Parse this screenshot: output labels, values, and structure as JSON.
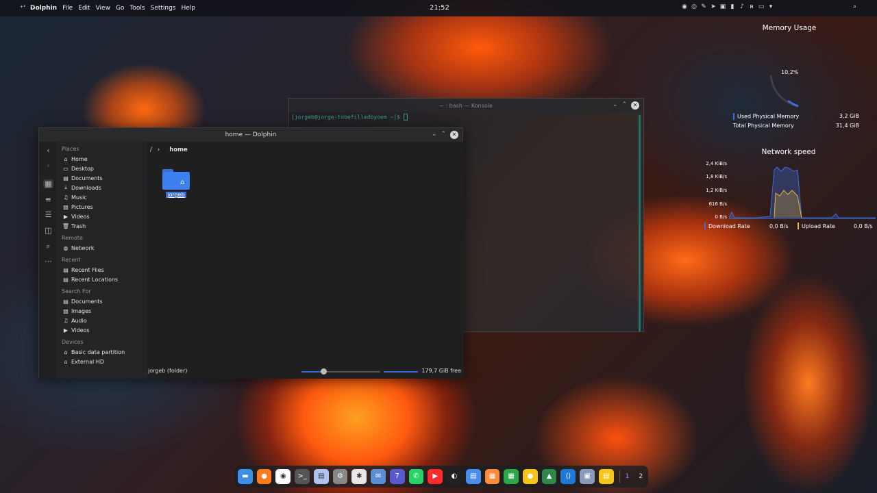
{
  "topbar": {
    "app": "Dolphin",
    "menu": [
      "File",
      "Edit",
      "View",
      "Go",
      "Tools",
      "Settings",
      "Help"
    ],
    "clock": "21:52"
  },
  "konsole": {
    "title": "~ : bash — Konsole",
    "prompt": "[jorgeb@jorge-tobefilledbyoem ~]$"
  },
  "dolphin": {
    "title": "home — Dolphin",
    "breadcrumb_root": "/",
    "breadcrumb_current": "home",
    "places": [
      {
        "header": "Places",
        "items": [
          {
            "icon": "home-icon",
            "label": "Home"
          },
          {
            "icon": "desktop-icon",
            "label": "Desktop"
          },
          {
            "icon": "documents-icon",
            "label": "Documents"
          },
          {
            "icon": "downloads-icon",
            "label": "Downloads"
          },
          {
            "icon": "music-icon",
            "label": "Music"
          },
          {
            "icon": "pictures-icon",
            "label": "Pictures"
          },
          {
            "icon": "videos-icon",
            "label": "Videos"
          },
          {
            "icon": "trash-icon",
            "label": "Trash"
          }
        ]
      },
      {
        "header": "Remote",
        "items": [
          {
            "icon": "network-icon",
            "label": "Network"
          }
        ]
      },
      {
        "header": "Recent",
        "items": [
          {
            "icon": "recent-files-icon",
            "label": "Recent Files"
          },
          {
            "icon": "recent-locations-icon",
            "label": "Recent Locations"
          }
        ]
      },
      {
        "header": "Search For",
        "items": [
          {
            "icon": "documents-icon",
            "label": "Documents"
          },
          {
            "icon": "images-icon",
            "label": "Images"
          },
          {
            "icon": "audio-icon",
            "label": "Audio"
          },
          {
            "icon": "videos-icon",
            "label": "Videos"
          }
        ]
      },
      {
        "header": "Devices",
        "items": [
          {
            "icon": "drive-icon",
            "label": "Basic data partition"
          },
          {
            "icon": "drive-icon",
            "label": "External HD"
          }
        ]
      }
    ],
    "folder": "jorgeb",
    "status": "jorgeb (folder)",
    "free": "179,7 GiB free"
  },
  "memory": {
    "title": "Memory Usage",
    "percent": "10,2%",
    "used_label": "Used Physical Memory",
    "used_value": "3,2 GiB",
    "total_label": "Total Physical Memory",
    "total_value": "31,4 GiB",
    "accent": "#3d6edb"
  },
  "network": {
    "title": "Network speed",
    "y_ticks": [
      "2,4 KiB/s",
      "1,8 KiB/s",
      "1,2 KiB/s",
      "616 B/s",
      "0 B/s"
    ],
    "download_label": "Download Rate",
    "download_value": "0,0 B/s",
    "upload_label": "Upload Rate",
    "upload_value": "0,0 B/s",
    "download_color": "#3d6edb",
    "upload_color": "#e8b830"
  },
  "dock": {
    "apps": [
      "files-icon",
      "firefox-icon",
      "chrome-icon",
      "terminal-icon",
      "notes-icon",
      "settings-icon",
      "slack-icon",
      "mail-icon",
      "calendar-icon",
      "whatsapp-icon",
      "youtube-icon",
      "obs-icon",
      "docs-icon",
      "slides-icon",
      "sheets-icon",
      "keep-icon",
      "monitor-icon",
      "vscode-icon",
      "screenshot-icon",
      "drive-icon"
    ],
    "calendar_day": "7",
    "workspaces": [
      "1",
      "2"
    ]
  }
}
